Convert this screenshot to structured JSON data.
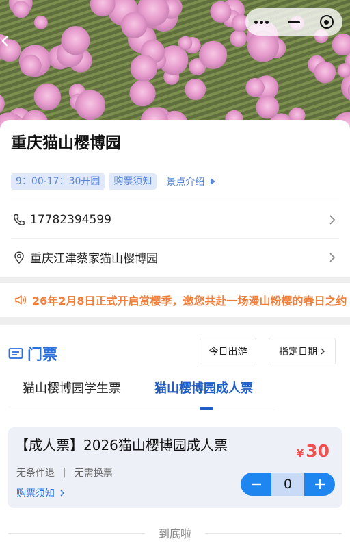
{
  "park": {
    "title": "重庆猫山樱博园",
    "tags": [
      "9：00-17：30开园",
      "购票须知"
    ],
    "intro_link": "景点介绍",
    "phone": "17782394599",
    "address": "重庆江津蔡家猫山樱博园"
  },
  "notice": {
    "text": "26年2月8日正式开启赏樱季，邀您共赴一场漫山粉樱的春日之约"
  },
  "tickets": {
    "section_title": "门票",
    "date_today": "今日出游",
    "date_pick": "指定日期",
    "tabs": [
      {
        "label": "猫山樱博园学生票",
        "active": false
      },
      {
        "label": "猫山樱博园成人票",
        "active": true
      }
    ],
    "item": {
      "name": "【成人票】2026猫山樱博园成人票",
      "currency": "¥",
      "price": "30",
      "features": [
        "无条件退",
        "无需换票"
      ],
      "feature_separator": "|",
      "notice_link": "购票须知",
      "quantity": "0"
    }
  },
  "footer": {
    "end_text": "到底啦"
  },
  "icons": {
    "capsule": [
      "more-dots-icon",
      "minimize-icon",
      "target-icon"
    ],
    "rows": [
      "phone-icon",
      "location-pin-icon",
      "chevron-right-icon"
    ],
    "notice": "speaker-icon",
    "section": "ticket-icon"
  },
  "colors": {
    "accent_blue": "#2a6fdb",
    "tag_bg": "#dfe9fb",
    "notice_orange": "#ef7f3a",
    "price_red": "#ef5050",
    "stepper_blue": "#1f86ef"
  }
}
